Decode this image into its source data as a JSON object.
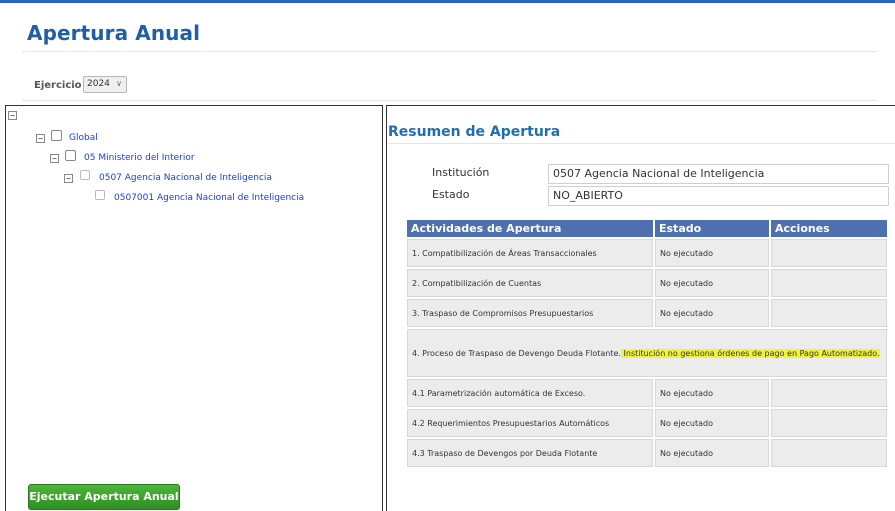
{
  "page": {
    "title": "Apertura Anual"
  },
  "ejercicio": {
    "label": "Ejercicio",
    "selected": "2024"
  },
  "tree": {
    "root_toggle": "−",
    "nodes": [
      {
        "label": "Global"
      },
      {
        "label": "05 Ministerio del Interior"
      },
      {
        "label": "0507 Agencia Nacional de Inteligencia"
      },
      {
        "label": "0507001 Agencia Nacional de Inteligencia"
      }
    ]
  },
  "actions": {
    "run_label": "Ejecutar Apertura Anual"
  },
  "summary": {
    "title": "Resumen de Apertura",
    "institucion_label": "Institución",
    "institucion_value": "0507 Agencia Nacional de Inteligencia",
    "estado_label": "Estado",
    "estado_value": "NO_ABIERTO"
  },
  "table": {
    "headers": [
      "Actividades de Apertura",
      "Estado",
      "Acciones"
    ],
    "rows": [
      {
        "actividad": "1. Compatibilización de Áreas Transaccionales",
        "estado": "No ejecutado"
      },
      {
        "actividad": "2. Compatibilización de Cuentas",
        "estado": "No ejecutado"
      },
      {
        "actividad": "3. Traspaso de Compromisos Presupuestarios",
        "estado": "No ejecutado"
      },
      {
        "actividad": "4. Proceso de Traspaso de Devengo Deuda Flotante.",
        "note": " Institución no gestiona órdenes de pago en Pago Automatizado."
      },
      {
        "actividad": "4.1 Parametrización automática de Exceso.",
        "estado": "No ejecutado"
      },
      {
        "actividad": "4.2 Requerimientos Presupuestarios Automáticos",
        "estado": "No ejecutado"
      },
      {
        "actividad": "4.3 Traspaso de Devengos por Deuda Flotante",
        "estado": "No ejecutado"
      }
    ]
  },
  "colors": {
    "header_bg": "#4e6fb0",
    "link": "#1a3fd6",
    "button": "#3a9e2a",
    "highlight": "#f2f23c",
    "title": "#1f5fa6"
  }
}
